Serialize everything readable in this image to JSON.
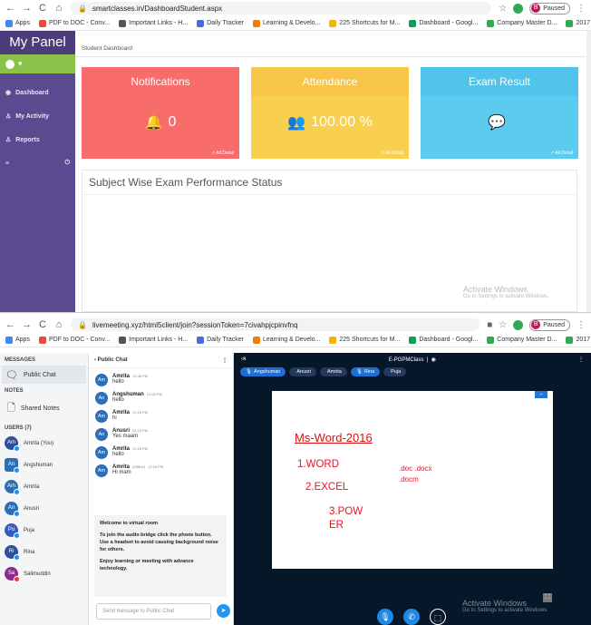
{
  "browser1": {
    "url": "smartclasses.in/DashboardStudent.aspx",
    "paused": "Paused",
    "paused_initial": "B"
  },
  "bookmarks": [
    {
      "label": "Apps",
      "color": "#4285f4"
    },
    {
      "label": "PDF to DOC - Conv...",
      "color": "#e74c3c"
    },
    {
      "label": "Important Links - H...",
      "color": "#555555"
    },
    {
      "label": "Daily Tracker",
      "color": "#4b6bdc"
    },
    {
      "label": "Learning & Develo...",
      "color": "#f57c00"
    },
    {
      "label": "225 Shortcuts for M...",
      "color": "#f4b400"
    },
    {
      "label": "Dashboard - Googl...",
      "color": "#0f9d58"
    },
    {
      "label": "Company Master D...",
      "color": "#34a853"
    },
    {
      "label": "2017 New Placeme...",
      "color": "#34a853"
    }
  ],
  "panel": {
    "title": "My Panel",
    "breadcrumb": "Student Dashboard",
    "menu": [
      "Dashboard",
      "My Activity",
      "Reports"
    ],
    "cards": [
      {
        "title": "Notifications",
        "value": "0",
        "icon": "bell-icon",
        "link": "All Detail",
        "color": "#f86c6b",
        "head": "#f86c6b"
      },
      {
        "title": "Attendance",
        "value": "100.00 %",
        "icon": "users-icon",
        "link": "All Detail",
        "color": "#f9cf4f",
        "head": "#f7c548"
      },
      {
        "title": "Exam Result",
        "value": "",
        "icon": "comments-icon",
        "link": "All Detail",
        "color": "#5bcbf0",
        "head": "#51c4ec"
      }
    ],
    "section_title": "Subject Wise Exam Performance Status",
    "activate_title": "Activate Windows",
    "activate_sub": "Go to Settings to activate Windows."
  },
  "browser2": {
    "url": "livemeeting.xyz/html5client/join?sessionToken=7civahpjcpinvfnq",
    "paused": "Paused",
    "paused_initial": "B"
  },
  "meeting": {
    "messages_header": "MESSAGES",
    "public_chat": "Public Chat",
    "notes_header": "NOTES",
    "shared_notes": "Shared Notes",
    "users_header": "USERS (7)",
    "users": [
      {
        "initials": "Am",
        "name": "Amrita (You)",
        "color": "#2c4fa3"
      },
      {
        "initials": "An",
        "name": "Angshuman",
        "color": "#2c6fb8"
      },
      {
        "initials": "Am",
        "name": "Amrita",
        "color": "#2c6fb8"
      },
      {
        "initials": "An",
        "name": "Anusri",
        "color": "#2c6fb8"
      },
      {
        "initials": "Pu",
        "name": "Puja",
        "color": "#3a5bb8"
      },
      {
        "initials": "Ri",
        "name": "Rina",
        "color": "#2c4fa3"
      },
      {
        "initials": "Sa",
        "name": "Salimuddin",
        "color": "#8e2b8a"
      }
    ],
    "chat_title": "Public Chat",
    "chat": [
      {
        "initials": "Am",
        "name": "Amrita",
        "time": "12:08 PM",
        "text": "hello"
      },
      {
        "initials": "An",
        "name": "Angshuman",
        "time": "12:08 PM",
        "text": "hello"
      },
      {
        "initials": "Am",
        "name": "Amrita",
        "time": "12:15 PM",
        "text": "hi"
      },
      {
        "initials": "An",
        "name": "Anusri",
        "time": "12:15 PM",
        "text": "Yes maam"
      },
      {
        "initials": "Am",
        "name": "Amrita",
        "time": "12:16 PM",
        "text": "hello"
      },
      {
        "initials": "Am",
        "name": "Amrita",
        "time": "12:16 PM",
        "text": "Hi mam",
        "tag": "(Offline)"
      }
    ],
    "welcome": [
      "Welcome to virtual room",
      "To join the audio bridge click the phone button. Use a headset to avoid causing background noise for others.",
      "Enjoy learning or meeting with advance technology."
    ],
    "chat_placeholder": "Send message to Public Chat",
    "room": "E-PGPMClass",
    "talkers": [
      "Angshuman",
      "Anusri",
      "Amrita",
      "Rina",
      "Puja"
    ],
    "slide": {
      "heading": "Ms-Word-2016",
      "line1": "1.WORD",
      "line2": "2.EXCEL",
      "line3a": "3.POW",
      "line3b": "ER",
      "ext1": ".doc  .docx",
      "ext2": ".docm"
    },
    "activate_title": "Activate Windows",
    "activate_sub": "Go to Settings to activate Windows."
  }
}
